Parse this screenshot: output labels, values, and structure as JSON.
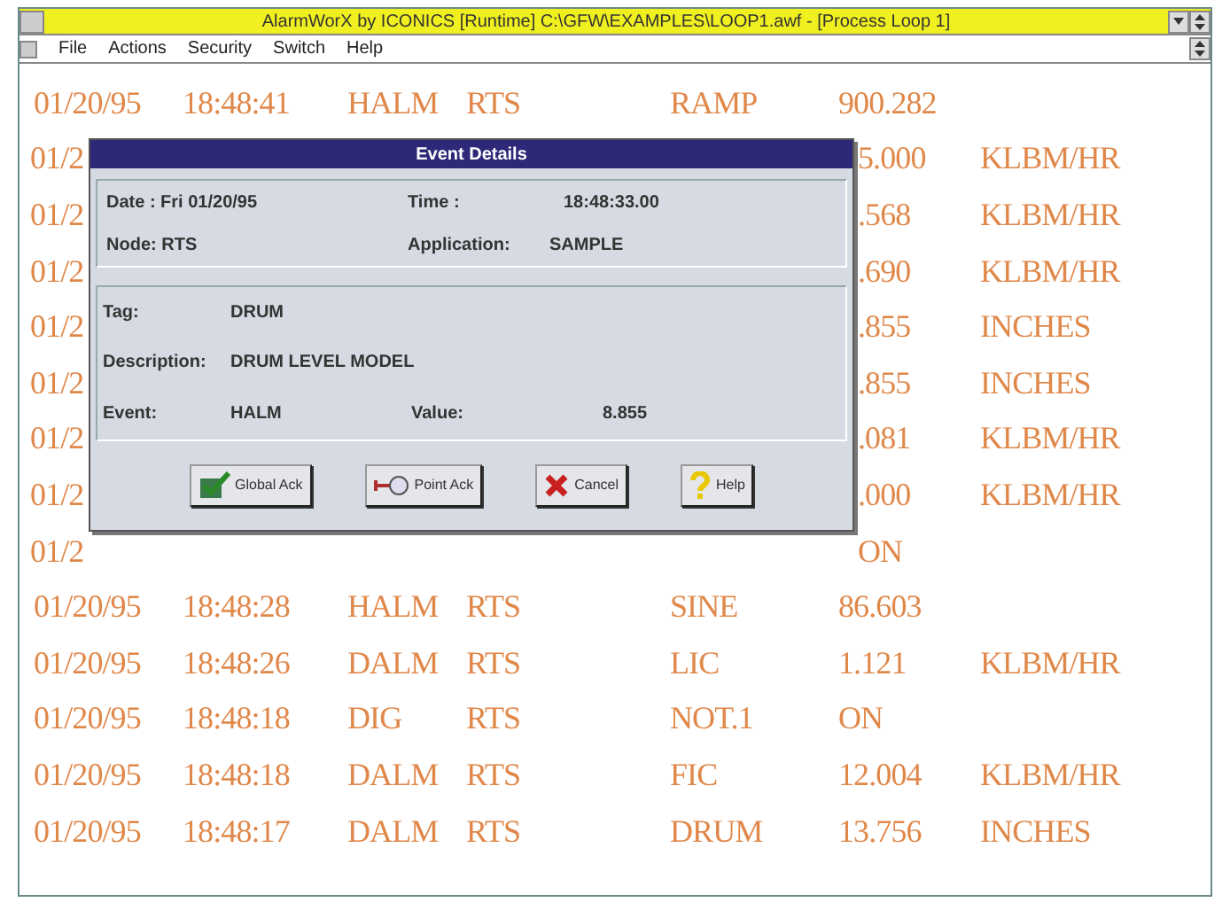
{
  "window": {
    "title": "AlarmWorX by ICONICS  [Runtime]   C:\\GFW\\EXAMPLES\\LOOP1.awf - [Process Loop 1]"
  },
  "menu": [
    "File",
    "Actions",
    "Security",
    "Switch",
    "Help"
  ],
  "rows": [
    {
      "kind": "full",
      "date": "01/20/95",
      "time": "18:48:41",
      "type": "HALM",
      "node": "RTS",
      "tag": "RAMP",
      "value": "900.282"
    },
    {
      "kind": "covered",
      "date": "01/2",
      "value": "5.000",
      "unit": "KLBM/HR"
    },
    {
      "kind": "covered",
      "date": "01/2",
      "value": ".568",
      "unit": "KLBM/HR"
    },
    {
      "kind": "covered",
      "date": "01/2",
      "value": ".690",
      "unit": "KLBM/HR"
    },
    {
      "kind": "covered",
      "date": "01/2",
      "value": ".855",
      "unit": "INCHES"
    },
    {
      "kind": "covered",
      "date": "01/2",
      "value": ".855",
      "unit": "INCHES"
    },
    {
      "kind": "covered",
      "date": "01/2",
      "value": ".081",
      "unit": "KLBM/HR"
    },
    {
      "kind": "covered",
      "date": "01/2",
      "value": ".000",
      "unit": "KLBM/HR"
    },
    {
      "kind": "covered",
      "date": "01/2",
      "value": "ON"
    },
    {
      "kind": "full",
      "date": "01/20/95",
      "time": "18:48:28",
      "type": "HALM",
      "node": "RTS",
      "tag": "SINE",
      "value": "86.603"
    },
    {
      "kind": "full",
      "date": "01/20/95",
      "time": "18:48:26",
      "type": "DALM",
      "node": "RTS",
      "tag": "LIC",
      "value": "1.121",
      "unit": "KLBM/HR"
    },
    {
      "kind": "full",
      "date": "01/20/95",
      "time": "18:48:18",
      "type": "DIG",
      "node": "RTS",
      "tag": "NOT.1",
      "value": "ON"
    },
    {
      "kind": "full",
      "date": "01/20/95",
      "time": "18:48:18",
      "type": "DALM",
      "node": "RTS",
      "tag": "FIC",
      "value": "12.004",
      "unit": "KLBM/HR"
    },
    {
      "kind": "full",
      "date": "01/20/95",
      "time": "18:48:17",
      "type": "DALM",
      "node": "RTS",
      "tag": "DRUM",
      "value": "13.756",
      "unit": "INCHES"
    }
  ],
  "dialog": {
    "title": "Event Details",
    "header": [
      {
        "label": "Date : Fri 01/20/95"
      },
      {
        "label": "Time :",
        "value": "18:48:33.00"
      },
      {
        "label": "Node: RTS"
      },
      {
        "label": "Application:",
        "value": "SAMPLE"
      }
    ],
    "tag": {
      "label": "Tag:",
      "value": "DRUM"
    },
    "description": {
      "label": "Description:",
      "value": "DRUM LEVEL MODEL"
    },
    "event": {
      "label": "Event:",
      "value": "HALM"
    },
    "event_value": {
      "label": "Value:",
      "value": "8.855"
    },
    "buttons": [
      {
        "kind": "global",
        "label": "Global Ack"
      },
      {
        "kind": "point",
        "label": "Point Ack"
      },
      {
        "kind": "cancel",
        "label": "Cancel"
      },
      {
        "kind": "help",
        "label": "Help"
      }
    ]
  }
}
